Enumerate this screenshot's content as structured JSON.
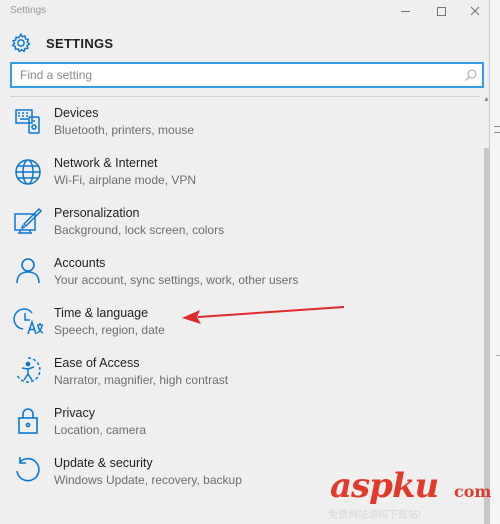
{
  "window": {
    "title": "Settings"
  },
  "header": {
    "title": "SETTINGS"
  },
  "search": {
    "placeholder": "Find a setting",
    "value": ""
  },
  "items": [
    {
      "label": "Devices",
      "desc": "Bluetooth, printers, mouse",
      "icon": "devices-icon"
    },
    {
      "label": "Network & Internet",
      "desc": "Wi-Fi, airplane mode, VPN",
      "icon": "globe-icon"
    },
    {
      "label": "Personalization",
      "desc": "Background, lock screen, colors",
      "icon": "personalization-icon"
    },
    {
      "label": "Accounts",
      "desc": "Your account, sync settings, work, other users",
      "icon": "person-icon"
    },
    {
      "label": "Time & language",
      "desc": "Speech, region, date",
      "icon": "time-language-icon"
    },
    {
      "label": "Ease of Access",
      "desc": "Narrator, magnifier, high contrast",
      "icon": "ease-of-access-icon"
    },
    {
      "label": "Privacy",
      "desc": "Location, camera",
      "icon": "lock-icon"
    },
    {
      "label": "Update & security",
      "desc": "Windows Update, recovery, backup",
      "icon": "update-icon"
    }
  ],
  "watermark": {
    "brand": "aspku",
    "suffix": "com",
    "tagline": "免费网站源码下载站!"
  },
  "colors": {
    "accent": "#0a78d2",
    "search_border": "#2f9ee3",
    "annotation": "#e02a2a",
    "watermark": "#e23a2a"
  }
}
